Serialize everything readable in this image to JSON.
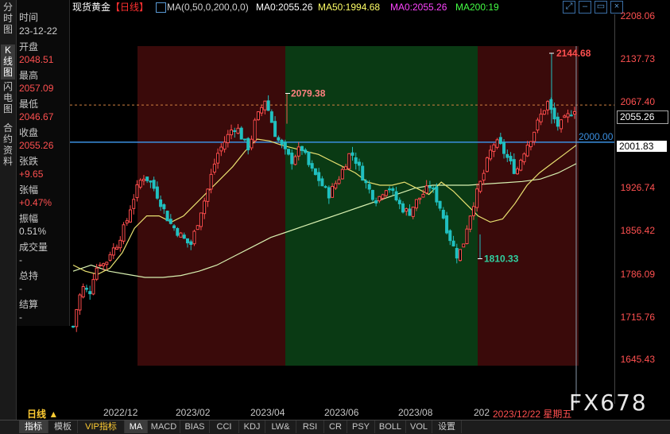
{
  "side_tabs": [
    "分时图",
    "K线图",
    "闪电图",
    "合约资料"
  ],
  "info": {
    "time_label": "时间",
    "time_value": "23-12-22",
    "open_label": "开盘",
    "open_value": "2048.51",
    "high_label": "最高",
    "high_value": "2057.09",
    "low_label": "最低",
    "low_value": "2046.67",
    "close_label": "收盘",
    "close_value": "2055.26",
    "change_label": "张跌",
    "change_value": "+9.65",
    "pct_label": "张幅",
    "pct_value": "+0.47%",
    "amp_label": "振幅",
    "amp_value": "0.51%",
    "vol_label": "成交量",
    "vol_value": "-",
    "oi_label": "总持",
    "oi_value": "-",
    "settle_label": "结算",
    "settle_value": "-"
  },
  "header": {
    "instrument": "现货黄金",
    "period": "【日线】",
    "ma_params": "MA(0,50,0,200,0,0)",
    "ma0": "MA0:2055.26",
    "ma50": "MA50:1994.68",
    "ma0b": "MA0:2055.26",
    "ma200": "MA200:19",
    "colors": {
      "ma50": "#ffff66",
      "ma0b": "#ff44ff",
      "ma200": "#44ff44"
    }
  },
  "window_buttons": [
    "full-screen",
    "minimize",
    "restore",
    "close"
  ],
  "chart_data": {
    "type": "candlestick",
    "ylim": [
      1645.43,
      2208.06
    ],
    "y_ticks": [
      "2208.06",
      "2137.73",
      "2067.40",
      "1926.74",
      "1856.42",
      "1786.09",
      "1715.76",
      "1645.43"
    ],
    "partial_tick": "2001.83",
    "current_price": "2055.26",
    "horizontal_line": {
      "label": "2000.00",
      "value": 2000.0
    },
    "dashed_line": {
      "value": 2060.5
    },
    "annotations": [
      {
        "label": "2079.38",
        "value": 2079.38
      },
      {
        "label": "2144.68",
        "value": 2144.68
      },
      {
        "label": "1810.33",
        "value": 1810.33
      },
      {
        "label": "1645.43",
        "value": 1645.43
      }
    ],
    "x_ticks": [
      "2022/12",
      "2023/02",
      "2023/04",
      "2023/06",
      "2023/08",
      "202"
    ],
    "cursor_label": "2023/12/22 星期五",
    "regions": [
      {
        "color": "red",
        "from": "2022/12",
        "to": "2023/05"
      },
      {
        "color": "green",
        "from": "2023/05",
        "to": "2023/10"
      },
      {
        "color": "red",
        "from": "2023/10",
        "to": "2023/12"
      }
    ],
    "close_path": [
      1700,
      1745,
      1765,
      1752,
      1790,
      1805,
      1800,
      1822,
      1830,
      1850,
      1870,
      1902,
      1925,
      1945,
      1940,
      1928,
      1910,
      1890,
      1870,
      1860,
      1850,
      1840,
      1832,
      1860,
      1890,
      1915,
      1950,
      1980,
      1995,
      2010,
      2025,
      2020,
      2000,
      1990,
      2030,
      2050,
      2070,
      2040,
      2010,
      1995,
      1980,
      1970,
      1985,
      1990,
      1965,
      1950,
      1940,
      1925,
      1915,
      1930,
      1945,
      1965,
      1985,
      1970,
      1950,
      1930,
      1915,
      1905,
      1920,
      1930,
      1915,
      1900,
      1890,
      1885,
      1900,
      1910,
      1920,
      1930,
      1910,
      1890,
      1860,
      1835,
      1815,
      1830,
      1870,
      1900,
      1925,
      1950,
      1980,
      2000,
      1995,
      1980,
      1965,
      1950,
      1975,
      1995,
      2010,
      2030,
      2050,
      2065,
      2040,
      2025,
      2035,
      2045,
      2055
    ],
    "ma50_path": [
      1800,
      1790,
      1785,
      1795,
      1820,
      1860,
      1880,
      1880,
      1870,
      1880,
      1900,
      1920,
      1940,
      1960,
      1985,
      2005,
      2002,
      1995,
      1990,
      1985,
      1980,
      1970,
      1960,
      1950,
      1935,
      1930,
      1930,
      1935,
      1925,
      1915,
      1935,
      1920,
      1900,
      1880,
      1870,
      1875,
      1900,
      1930,
      1950,
      1965,
      1980,
      1995
    ],
    "ma200_path": [
      1790,
      1800,
      1790,
      1785,
      1780,
      1780,
      1783,
      1790,
      1800,
      1815,
      1830,
      1845,
      1855,
      1865,
      1875,
      1885,
      1895,
      1905,
      1915,
      1925,
      1930,
      1930,
      1930,
      1932,
      1934,
      1936,
      1940,
      1950,
      1965
    ],
    "end_labels": [
      "FX678"
    ]
  },
  "xaxis_left": "日线",
  "bottom_tabs": [
    "指标",
    "模板",
    "VIP指标",
    "MA",
    "MACD",
    "BIAS",
    "CCI",
    "KDJ",
    "LW&",
    "RSI",
    "CR",
    "PSY",
    "BOLL",
    "VOL",
    "设置"
  ],
  "watermark": "FX678"
}
